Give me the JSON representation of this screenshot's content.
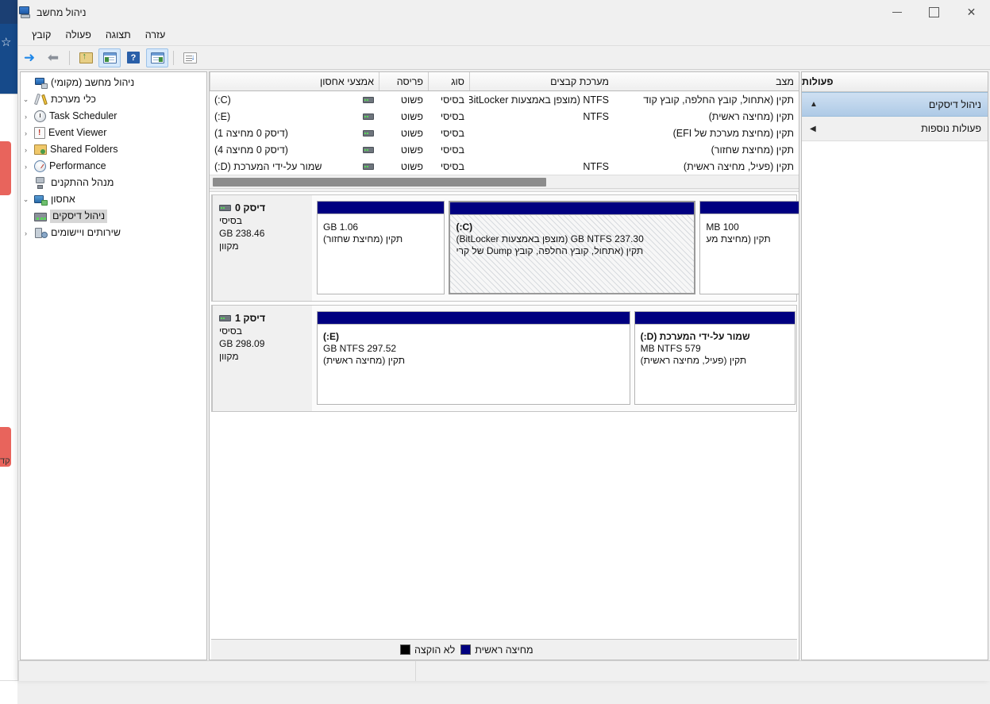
{
  "window": {
    "title": "ניהול מחשב",
    "app_icon": "computer-management-icon",
    "buttons": {
      "minimize": "—",
      "maximize": "□",
      "close": "✕"
    }
  },
  "menubar": {
    "items": [
      {
        "label": "קובץ",
        "name": "menu-file"
      },
      {
        "label": "פעולה",
        "name": "menu-action"
      },
      {
        "label": "תצוגה",
        "name": "menu-view"
      },
      {
        "label": "עזרה",
        "name": "menu-help"
      }
    ]
  },
  "toolbar": {
    "items": [
      {
        "name": "forward-button",
        "icon": "arrow-right-icon"
      },
      {
        "name": "back-button",
        "icon": "arrow-left-icon"
      },
      {
        "name": "up-one-level-button",
        "icon": "folder-up-icon"
      },
      {
        "name": "show-hide-console-tree-button",
        "icon": "console-tree-icon"
      },
      {
        "name": "help-button",
        "icon": "help-icon"
      },
      {
        "name": "show-hide-action-pane-button",
        "icon": "action-pane-icon"
      },
      {
        "name": "properties-button",
        "icon": "properties-icon"
      }
    ]
  },
  "console_tree": {
    "items": [
      {
        "label": "ניהול מחשב (מקומי)",
        "icon": "computer-icon",
        "twisty": "",
        "indent": 0,
        "selected": false,
        "name": "tree-item-computer-management-local"
      },
      {
        "label": "כלי מערכת",
        "icon": "system-tools-icon",
        "twisty": "⌄",
        "indent": 1,
        "selected": false,
        "name": "tree-item-system-tools"
      },
      {
        "label": "Task Scheduler",
        "icon": "clock-icon",
        "twisty": "‹",
        "indent": 2,
        "selected": false,
        "name": "tree-item-task-scheduler"
      },
      {
        "label": "Event Viewer",
        "icon": "event-viewer-icon",
        "twisty": "‹",
        "indent": 2,
        "selected": false,
        "name": "tree-item-event-viewer"
      },
      {
        "label": "Shared Folders",
        "icon": "shared-folders-icon",
        "twisty": "‹",
        "indent": 2,
        "selected": false,
        "name": "tree-item-shared-folders"
      },
      {
        "label": "Performance",
        "icon": "performance-icon",
        "twisty": "‹",
        "indent": 2,
        "selected": false,
        "name": "tree-item-performance"
      },
      {
        "label": "מנהל ההתקנים",
        "icon": "device-manager-icon",
        "twisty": "",
        "indent": 2,
        "selected": false,
        "name": "tree-item-device-manager"
      },
      {
        "label": "אחסון",
        "icon": "storage-icon",
        "twisty": "⌄",
        "indent": 1,
        "selected": false,
        "name": "tree-item-storage"
      },
      {
        "label": "ניהול דיסקים",
        "icon": "disk-management-icon",
        "twisty": "",
        "indent": 2,
        "selected": true,
        "name": "tree-item-disk-management"
      },
      {
        "label": "שירותים ויישומים",
        "icon": "services-icon",
        "twisty": "‹",
        "indent": 1,
        "selected": false,
        "name": "tree-item-services-and-applications"
      }
    ]
  },
  "volume_list": {
    "columns": [
      {
        "label": "אמצעי אחסון",
        "name": "col-volume"
      },
      {
        "label": "פריסה",
        "name": "col-layout"
      },
      {
        "label": "סוג",
        "name": "col-type"
      },
      {
        "label": "מערכת קבצים",
        "name": "col-filesystem"
      },
      {
        "label": "מצב",
        "name": "col-status"
      }
    ],
    "rows": [
      {
        "volume": "(C:)",
        "layout": "פשוט",
        "type": "בסיסי",
        "filesystem": "NTFS (מוצפן באמצעות BitLocker)",
        "status": "תקין (אתחול, קובץ החלפה, קובץ קוד"
      },
      {
        "volume": "(E:)",
        "layout": "פשוט",
        "type": "בסיסי",
        "filesystem": "NTFS",
        "status": "תקין (מחיצה ראשית)"
      },
      {
        "volume": "(דיסק 0 מחיצה 1)",
        "layout": "פשוט",
        "type": "בסיסי",
        "filesystem": "",
        "status": "תקין (מחיצת מערכת של EFI)"
      },
      {
        "volume": "(דיסק 0 מחיצה 4)",
        "layout": "פשוט",
        "type": "בסיסי",
        "filesystem": "",
        "status": "תקין (מחיצת שחזור)"
      },
      {
        "volume": "שמור על-ידי המערכת (D:)",
        "layout": "פשוט",
        "type": "בסיסי",
        "filesystem": "NTFS",
        "status": "תקין (פעיל, מחיצה ראשית)"
      }
    ]
  },
  "graphical_view": {
    "disks": [
      {
        "name": "דיסק 0",
        "type": "בסיסי",
        "size": "238.46 GB",
        "state": "מקוון",
        "partitions": [
          {
            "name": "disk0-partition-recovery",
            "label": "",
            "size": "1.06 GB",
            "status": "תקין (מחיצת שחזור)",
            "width_pct": 27,
            "selected": false,
            "unallocated": false
          },
          {
            "name": "disk0-partition-c",
            "label": "(C:)",
            "size": "237.30 GB NTFS (מוצפן באמצעות BitLocker)",
            "status": "תקין (אתחול, קובץ החלפה, קובץ Dump של קרי",
            "width_pct": 52,
            "selected": true,
            "unallocated": false
          },
          {
            "name": "disk0-partition-efi",
            "label": "",
            "size": "100 MB",
            "status": "תקין (מחיצת מע",
            "width_pct": 21,
            "selected": false,
            "unallocated": false
          }
        ]
      },
      {
        "name": "דיסק 1",
        "type": "בסיסי",
        "size": "298.09 GB",
        "state": "מקוון",
        "partitions": [
          {
            "name": "disk1-partition-e",
            "label": "(E:)",
            "size": "297.52 GB NTFS",
            "status": "תקין (מחיצה ראשית)",
            "width_pct": 66,
            "selected": false,
            "unallocated": false
          },
          {
            "name": "disk1-partition-d",
            "label": "שמור על-ידי המערכת  (D:)",
            "size": "579 MB NTFS",
            "status": "תקין (פעיל, מחיצה ראשית)",
            "width_pct": 34,
            "selected": false,
            "unallocated": false
          }
        ]
      }
    ]
  },
  "legend": {
    "items": [
      {
        "label": "לא הוקצה",
        "swatch": "black",
        "name": "legend-unallocated"
      },
      {
        "label": "מחיצה ראשית",
        "swatch": "blue",
        "name": "legend-primary-partition"
      }
    ]
  },
  "actions_pane": {
    "header": "פעולות",
    "items": [
      {
        "label": "ניהול דיסקים",
        "caret": "▲",
        "selected": true,
        "name": "action-disk-management"
      },
      {
        "label": "פעולות נוספות",
        "caret": "◀",
        "selected": false,
        "name": "action-more-actions"
      }
    ]
  },
  "statusbar": {
    "cell1": "",
    "cell2": "",
    "cell3": ""
  },
  "background": {
    "side_text": "קד"
  },
  "colors": {
    "primary_partition": "#000080",
    "unallocated": "#000000",
    "selection": "#aecae6",
    "window_bg": "#f0f0f0"
  }
}
